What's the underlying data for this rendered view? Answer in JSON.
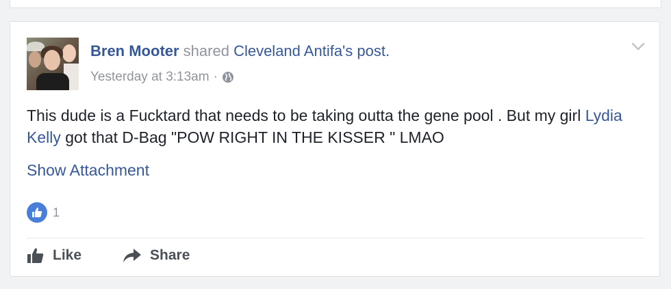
{
  "post": {
    "author_name": "Bren Mooter",
    "shared_text": " shared ",
    "shared_page": "Cleveland Antifa's post.",
    "timestamp": "Yesterday at 3:13am",
    "separator": "·",
    "body_part1": "This dude is a Fucktard that needs to be taking outta the gene pool . But my girl ",
    "mention": "Lydia Kelly",
    "body_part2": " got that D-Bag \"POW RIGHT IN THE KISSER \" LMAO",
    "show_attachment": "Show Attachment",
    "reaction_count": "1"
  },
  "actions": {
    "like_label": "Like",
    "share_label": "Share"
  },
  "icons": {
    "privacy": "globe-icon",
    "menu": "chevron-down-icon",
    "reaction": "like-reaction-icon",
    "like": "thumbs-up-icon",
    "share": "share-arrow-icon"
  },
  "colors": {
    "link": "#365899",
    "meta": "#90949c",
    "text": "#1d2129",
    "like_badge": "#4a7fd9"
  }
}
